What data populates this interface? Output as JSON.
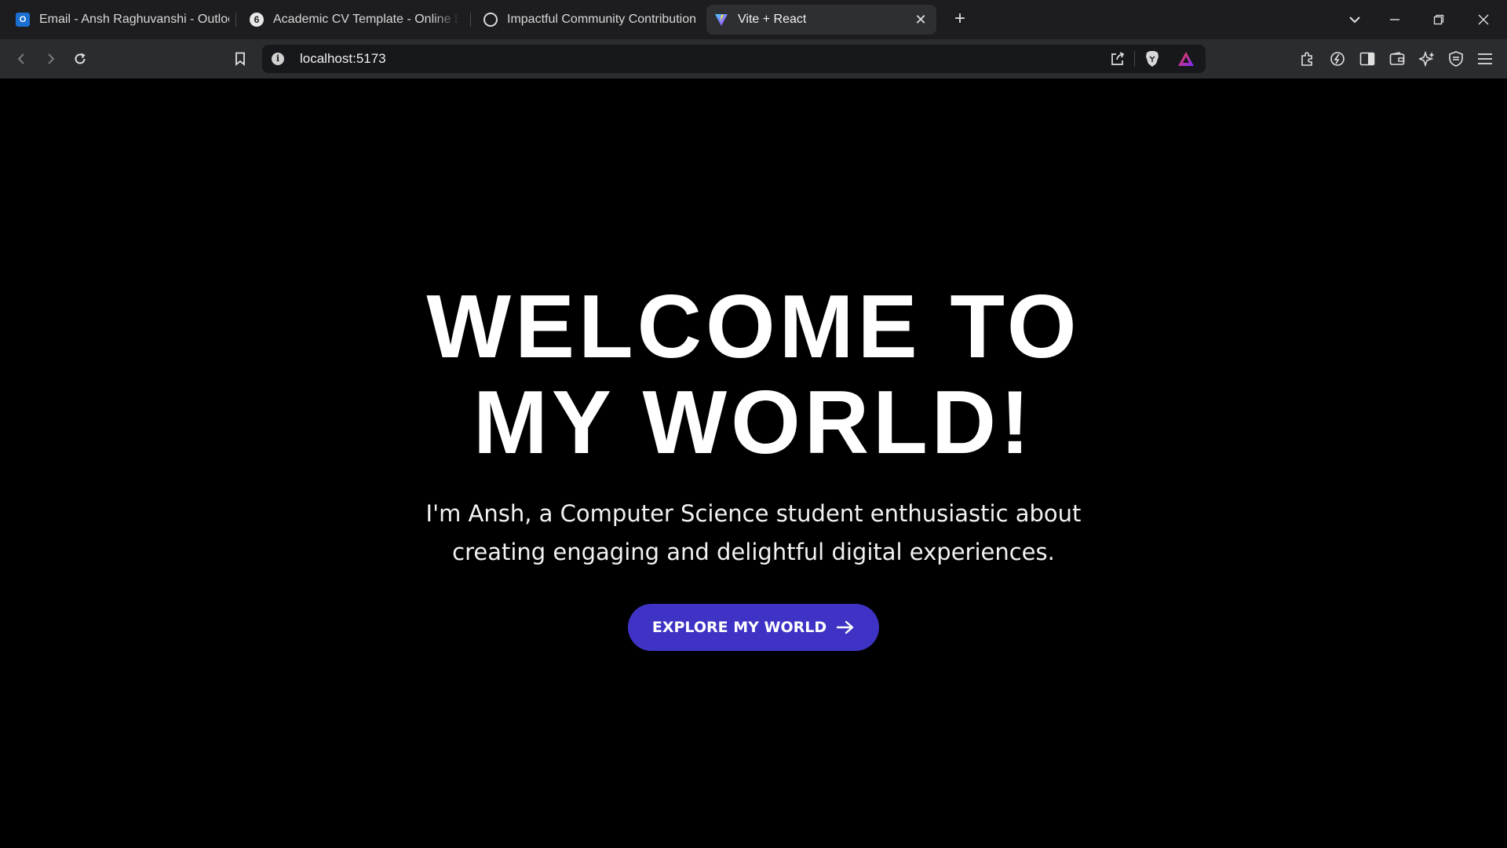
{
  "browser": {
    "tabs": [
      {
        "title": "Email - Ansh Raghuvanshi - Outlook",
        "icon": "outlook-icon",
        "active": false
      },
      {
        "title": "Academic CV Template - Online LaTeX",
        "icon": "overleaf-icon",
        "active": false
      },
      {
        "title": "Impactful Community Contributions",
        "icon": "chatgpt-icon",
        "active": false
      },
      {
        "title": "Vite + React",
        "icon": "vite-icon",
        "active": true
      }
    ],
    "address": "localhost:5173"
  },
  "hero": {
    "title_line1": "WELCOME TO",
    "title_line2": "MY WORLD!",
    "subtitle_line1": "I'm Ansh, a Computer Science student enthusiastic about",
    "subtitle_line2": "creating engaging and delightful digital experiences.",
    "cta_label": "EXPLORE MY WORLD"
  },
  "colors": {
    "page_background": "#000000",
    "cta_background": "#3f33c5",
    "text": "#ffffff"
  }
}
